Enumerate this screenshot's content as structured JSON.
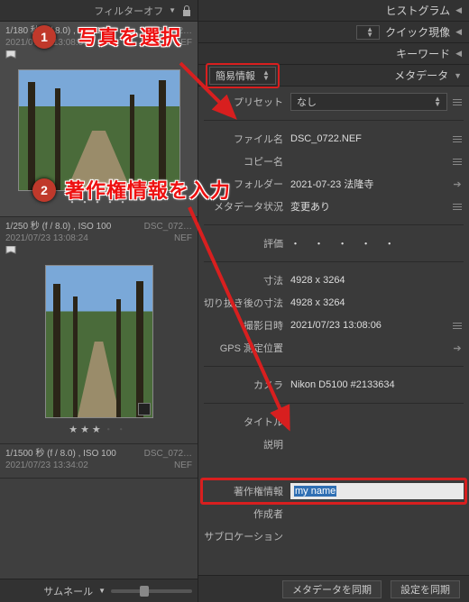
{
  "left": {
    "filter_label": "フィルターオフ",
    "thumbs": [
      {
        "info": "1/180 秒 (f / 8.0) , ISO 100",
        "file": "DSC_072…",
        "date": "2021/07/23 13:08:07",
        "ext": "NEF",
        "stars": "・・・・・"
      },
      {
        "info": "1/250 秒 (f / 8.0) , ISO 100",
        "file": "DSC_072…",
        "date": "2021/07/23 13:08:24",
        "ext": "NEF",
        "stars3": "★★★",
        "stars_off": "・・"
      },
      {
        "info": "1/1500 秒 (f / 8.0) , ISO 100",
        "file": "DSC_072…",
        "date": "2021/07/23 13:34:02",
        "ext": "NEF"
      }
    ],
    "thumbnail_label": "サムネール"
  },
  "panels": {
    "histogram": "ヒストグラム",
    "quick": "クイック現像",
    "keywords": "キーワード",
    "metadata": "メタデータ"
  },
  "meta": {
    "mode": "簡易情報",
    "preset_label": "プリセット",
    "preset_value": "なし",
    "filename_label": "ファイル名",
    "filename_value": "DSC_0722.NEF",
    "copyname_label": "コピー名",
    "folder_label": "フォルダー",
    "folder_value": "2021-07-23 法隆寺",
    "metastate_label": "メタデータ状況",
    "metastate_value": "変更あり",
    "rating_label": "評価",
    "rating_value": "・ ・ ・ ・ ・",
    "dim_label": "寸法",
    "dim_value": "4928 x 3264",
    "crop_label": "切り抜き後の寸法",
    "crop_value": "4928 x 3264",
    "shotdate_label": "撮影日時",
    "shotdate_value": "2021/07/23 13:08:06",
    "gps_label": "GPS 測定位置",
    "camera_label": "カメラ",
    "camera_value": "Nikon D5100 #2133634",
    "title_label": "タイトル",
    "caption_label": "説明",
    "copyright_label": "著作権情報",
    "copyright_value": "my name",
    "creator_label": "作成者",
    "subloc_label": "サブロケーション"
  },
  "buttons": {
    "sync_meta": "メタデータを同期",
    "sync_settings": "設定を同期"
  },
  "annotations": {
    "a1": "写真を選択",
    "a2": "著作権情報を入力"
  }
}
